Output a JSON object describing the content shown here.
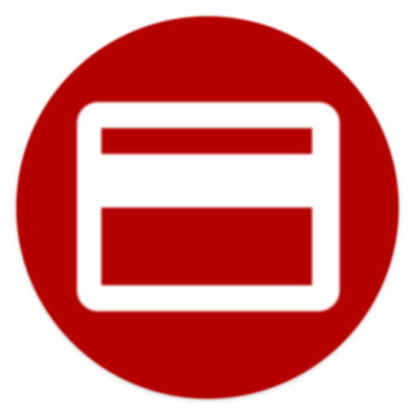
{
  "icon": {
    "name": "payment-card-icon",
    "background_color": "#b50000",
    "glyph_color": "#ffffff"
  }
}
